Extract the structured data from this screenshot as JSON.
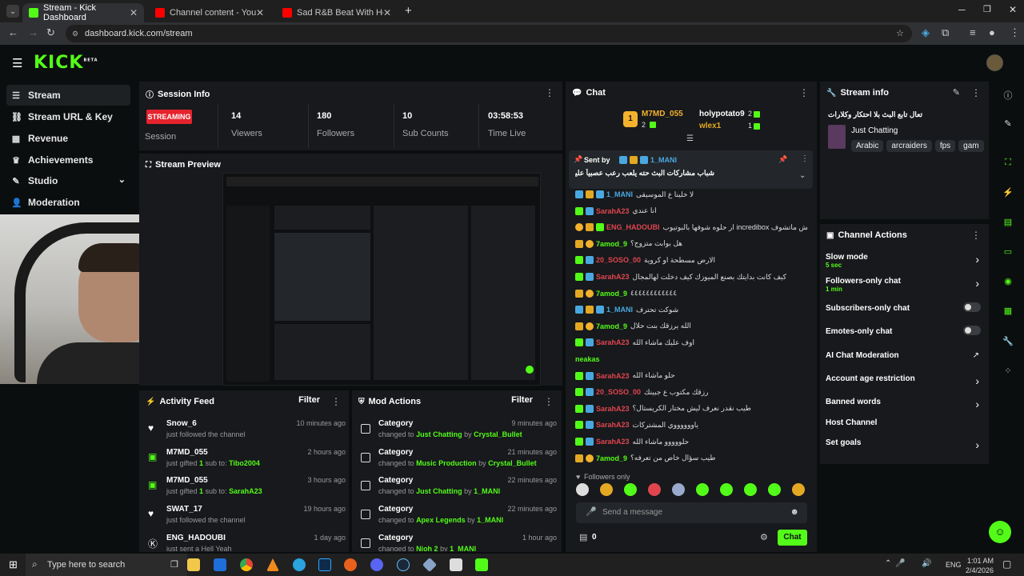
{
  "browser": {
    "tabs": [
      {
        "title": "Stream - Kick Dashboard",
        "active": true
      },
      {
        "title": "Channel content - YouTube Stu",
        "active": false
      },
      {
        "title": "Sad R&B Beat With Hook - Bea",
        "active": false
      }
    ],
    "url": "dashboard.kick.com/stream"
  },
  "kick": {
    "logo": "KICK",
    "logo_sup": "BETA"
  },
  "sidebar": {
    "items": [
      {
        "label": "Stream",
        "icon": "list-icon"
      },
      {
        "label": "Stream URL & Key",
        "icon": "link-icon"
      },
      {
        "label": "Revenue",
        "icon": "chart-icon"
      },
      {
        "label": "Achievements",
        "icon": "trophy-icon"
      },
      {
        "label": "Studio",
        "icon": "studio-icon"
      },
      {
        "label": "Moderation",
        "icon": "user-icon"
      }
    ]
  },
  "session": {
    "title": "Session Info",
    "status": "STREAMING",
    "status_label": "Session",
    "stats": [
      {
        "value": "14",
        "label": "Viewers"
      },
      {
        "value": "180",
        "label": "Followers"
      },
      {
        "value": "10",
        "label": "Sub Counts"
      },
      {
        "value": "03:58:53",
        "label": "Time Live"
      }
    ]
  },
  "preview": {
    "title": "Stream Preview"
  },
  "activity": {
    "title": "Activity Feed",
    "filter": "Filter",
    "items": [
      {
        "name": "Snow_6",
        "desc": "just followed the channel",
        "time": "10 minutes ago",
        "icon": "heart-icon"
      },
      {
        "name": "M7MD_055",
        "desc_pre": "just gifted ",
        "desc_num": "1",
        "desc_mid": " sub to: ",
        "desc_user": "Tibo2004",
        "time": "2 hours ago",
        "icon": "gift-icon"
      },
      {
        "name": "M7MD_055",
        "desc_pre": "just gifted ",
        "desc_num": "1",
        "desc_mid": " sub to: ",
        "desc_user": "SarahA23",
        "time": "3 hours ago",
        "icon": "gift-icon"
      },
      {
        "name": "SWAT_17",
        "desc": "just followed the channel",
        "time": "19 hours ago",
        "icon": "heart-icon"
      },
      {
        "name": "ENG_HADOUBI",
        "desc": "just sent a Hell Yeah",
        "time": "1 day ago",
        "icon": "kick-icon"
      }
    ]
  },
  "modactions": {
    "title": "Mod Actions",
    "filter": "Filter",
    "items": [
      {
        "name": "Category",
        "to": "Just Chatting",
        "by": "Crystal_Bullet",
        "time": "9 minutes ago"
      },
      {
        "name": "Category",
        "to": "Music Production",
        "by": "Crystal_Bullet",
        "time": "21 minutes ago"
      },
      {
        "name": "Category",
        "to": "Just Chatting",
        "by": "1_MANI",
        "time": "22 minutes ago"
      },
      {
        "name": "Category",
        "to": "Apex Legends",
        "by": "1_MANI",
        "time": "22 minutes ago"
      },
      {
        "name": "Category",
        "to": "Nioh 2",
        "by": "1_MANI",
        "time": "1 hour ago"
      }
    ],
    "changed_to": "changed to",
    "by_word": "by"
  },
  "chat": {
    "title": "Chat",
    "top_gifters": [
      {
        "name": "M7MD_055",
        "count": "2"
      },
      {
        "name": "holypotato9",
        "count": "2"
      },
      {
        "name": "wlex1",
        "count": "1"
      }
    ],
    "pinned": {
      "sent_by": "Sent by",
      "user": "1_MANI",
      "text": "شباب مشاركات البث حته يلعب رعب عصبياً عليه"
    },
    "messages": [
      {
        "user": "1_MANI",
        "color": "#4aa8e0",
        "text": "لا خلينا ع الموسيقى",
        "badges": [
          "b-blue",
          "b-crown",
          "b-blue"
        ]
      },
      {
        "user": "SarahA23",
        "color": "#e0454f",
        "text": "انا عندي",
        "badges": [
          "b-green",
          "b-blue"
        ]
      },
      {
        "user": "ENG_HADOUBI",
        "color": "#e0454f",
        "text": "ار حلوه شوفها بالبوتيوب incredibox ايش ماتشوف",
        "badges": [
          "b-gold",
          "b-crown",
          "b-green"
        ]
      },
      {
        "user": "7amod_9",
        "color": "#53fc18",
        "text": "هل بوابت متزوج؟",
        "badges": [
          "b-crown",
          "b-gold"
        ]
      },
      {
        "user": "20_SOSO_00",
        "color": "#e0454f",
        "text": "الارض مسطحة او كروية",
        "badges": [
          "b-green",
          "b-blue"
        ]
      },
      {
        "user": "SarahA23",
        "color": "#e0454f",
        "text": "كيف كانت بدايتك بصنع الميوزك كيف دخلت لهالمجال",
        "badges": [
          "b-green",
          "b-blue"
        ]
      },
      {
        "user": "7amod_9",
        "color": "#53fc18",
        "text": "٤٤٤٤٤٤٤٤٤٤٤٤",
        "badges": [
          "b-crown",
          "b-gold"
        ]
      },
      {
        "user": "1_MANI",
        "color": "#4aa8e0",
        "text": "شوكت تحترف",
        "badges": [
          "b-blue",
          "b-crown",
          "b-blue"
        ]
      },
      {
        "user": "7amod_9",
        "color": "#53fc18",
        "text": "الله يرزقك بنت حلال",
        "badges": [
          "b-crown",
          "b-gold"
        ]
      },
      {
        "user": "SarahA23",
        "color": "#e0454f",
        "text": "اوف عليك ماشاء الله",
        "badges": [
          "b-green",
          "b-blue"
        ]
      },
      {
        "user": "neakas",
        "color": "#53fc18",
        "text": "",
        "badges": []
      },
      {
        "user": "SarahA23",
        "color": "#e0454f",
        "text": "حلو ماشاء الله",
        "badges": [
          "b-green",
          "b-blue"
        ]
      },
      {
        "user": "20_SOSO_00",
        "color": "#e0454f",
        "text": "رزقك مكتوب ع جبينك",
        "badges": [
          "b-green",
          "b-blue"
        ]
      },
      {
        "user": "SarahA23",
        "color": "#e0454f",
        "text": "طيب نقدر نعرف ليش مختار الكريستال؟",
        "badges": [
          "b-green",
          "b-blue"
        ]
      },
      {
        "user": "SarahA23",
        "color": "#e0454f",
        "text": "ياووووووي المشتركات",
        "badges": [
          "b-green",
          "b-blue"
        ]
      },
      {
        "user": "SarahA23",
        "color": "#e0454f",
        "text": "حلووووو ماشاء الله",
        "badges": [
          "b-green",
          "b-blue"
        ]
      },
      {
        "user": "7amod_9",
        "color": "#53fc18",
        "text": "طيب سؤال خاص من تعرفه؟",
        "badges": [
          "b-crown",
          "b-gold"
        ]
      }
    ],
    "followers_only": "Followers only",
    "placeholder": "Send a message",
    "count": "0",
    "send": "Chat"
  },
  "streaminfo": {
    "title": "Stream info",
    "stream_title": "تعال تابع البث بلا احتكار وكلارات",
    "category": "Just Chatting",
    "tags": [
      "Arabic",
      "arcraiders",
      "fps",
      "gam"
    ]
  },
  "channelactions": {
    "title": "Channel Actions",
    "items": [
      {
        "label": "Slow mode",
        "sub": "5 sec",
        "type": "arrow"
      },
      {
        "label": "Followers-only chat",
        "sub": "1 min",
        "type": "arrow"
      },
      {
        "label": "Subscribers-only chat",
        "sub": "",
        "type": "toggle"
      },
      {
        "label": "Emotes-only chat",
        "sub": "",
        "type": "toggle"
      },
      {
        "label": "AI Chat Moderation",
        "sub": "",
        "type": "external"
      },
      {
        "label": "Account age restriction",
        "sub": "",
        "type": "arrow"
      },
      {
        "label": "Banned words",
        "sub": "",
        "type": "arrow"
      },
      {
        "label": "Host Channel",
        "sub": "",
        "type": "none"
      },
      {
        "label": "Set goals",
        "sub": "",
        "type": "arrow"
      }
    ]
  },
  "taskbar": {
    "search_placeholder": "Type here to search",
    "lang": "ENG",
    "time": "1:01 AM",
    "date": "2/4/2026"
  },
  "colors": {
    "accent": "#53fc18",
    "streaming": "#e5232d",
    "panel": "#17191c",
    "bg": "#0b0e0f"
  }
}
